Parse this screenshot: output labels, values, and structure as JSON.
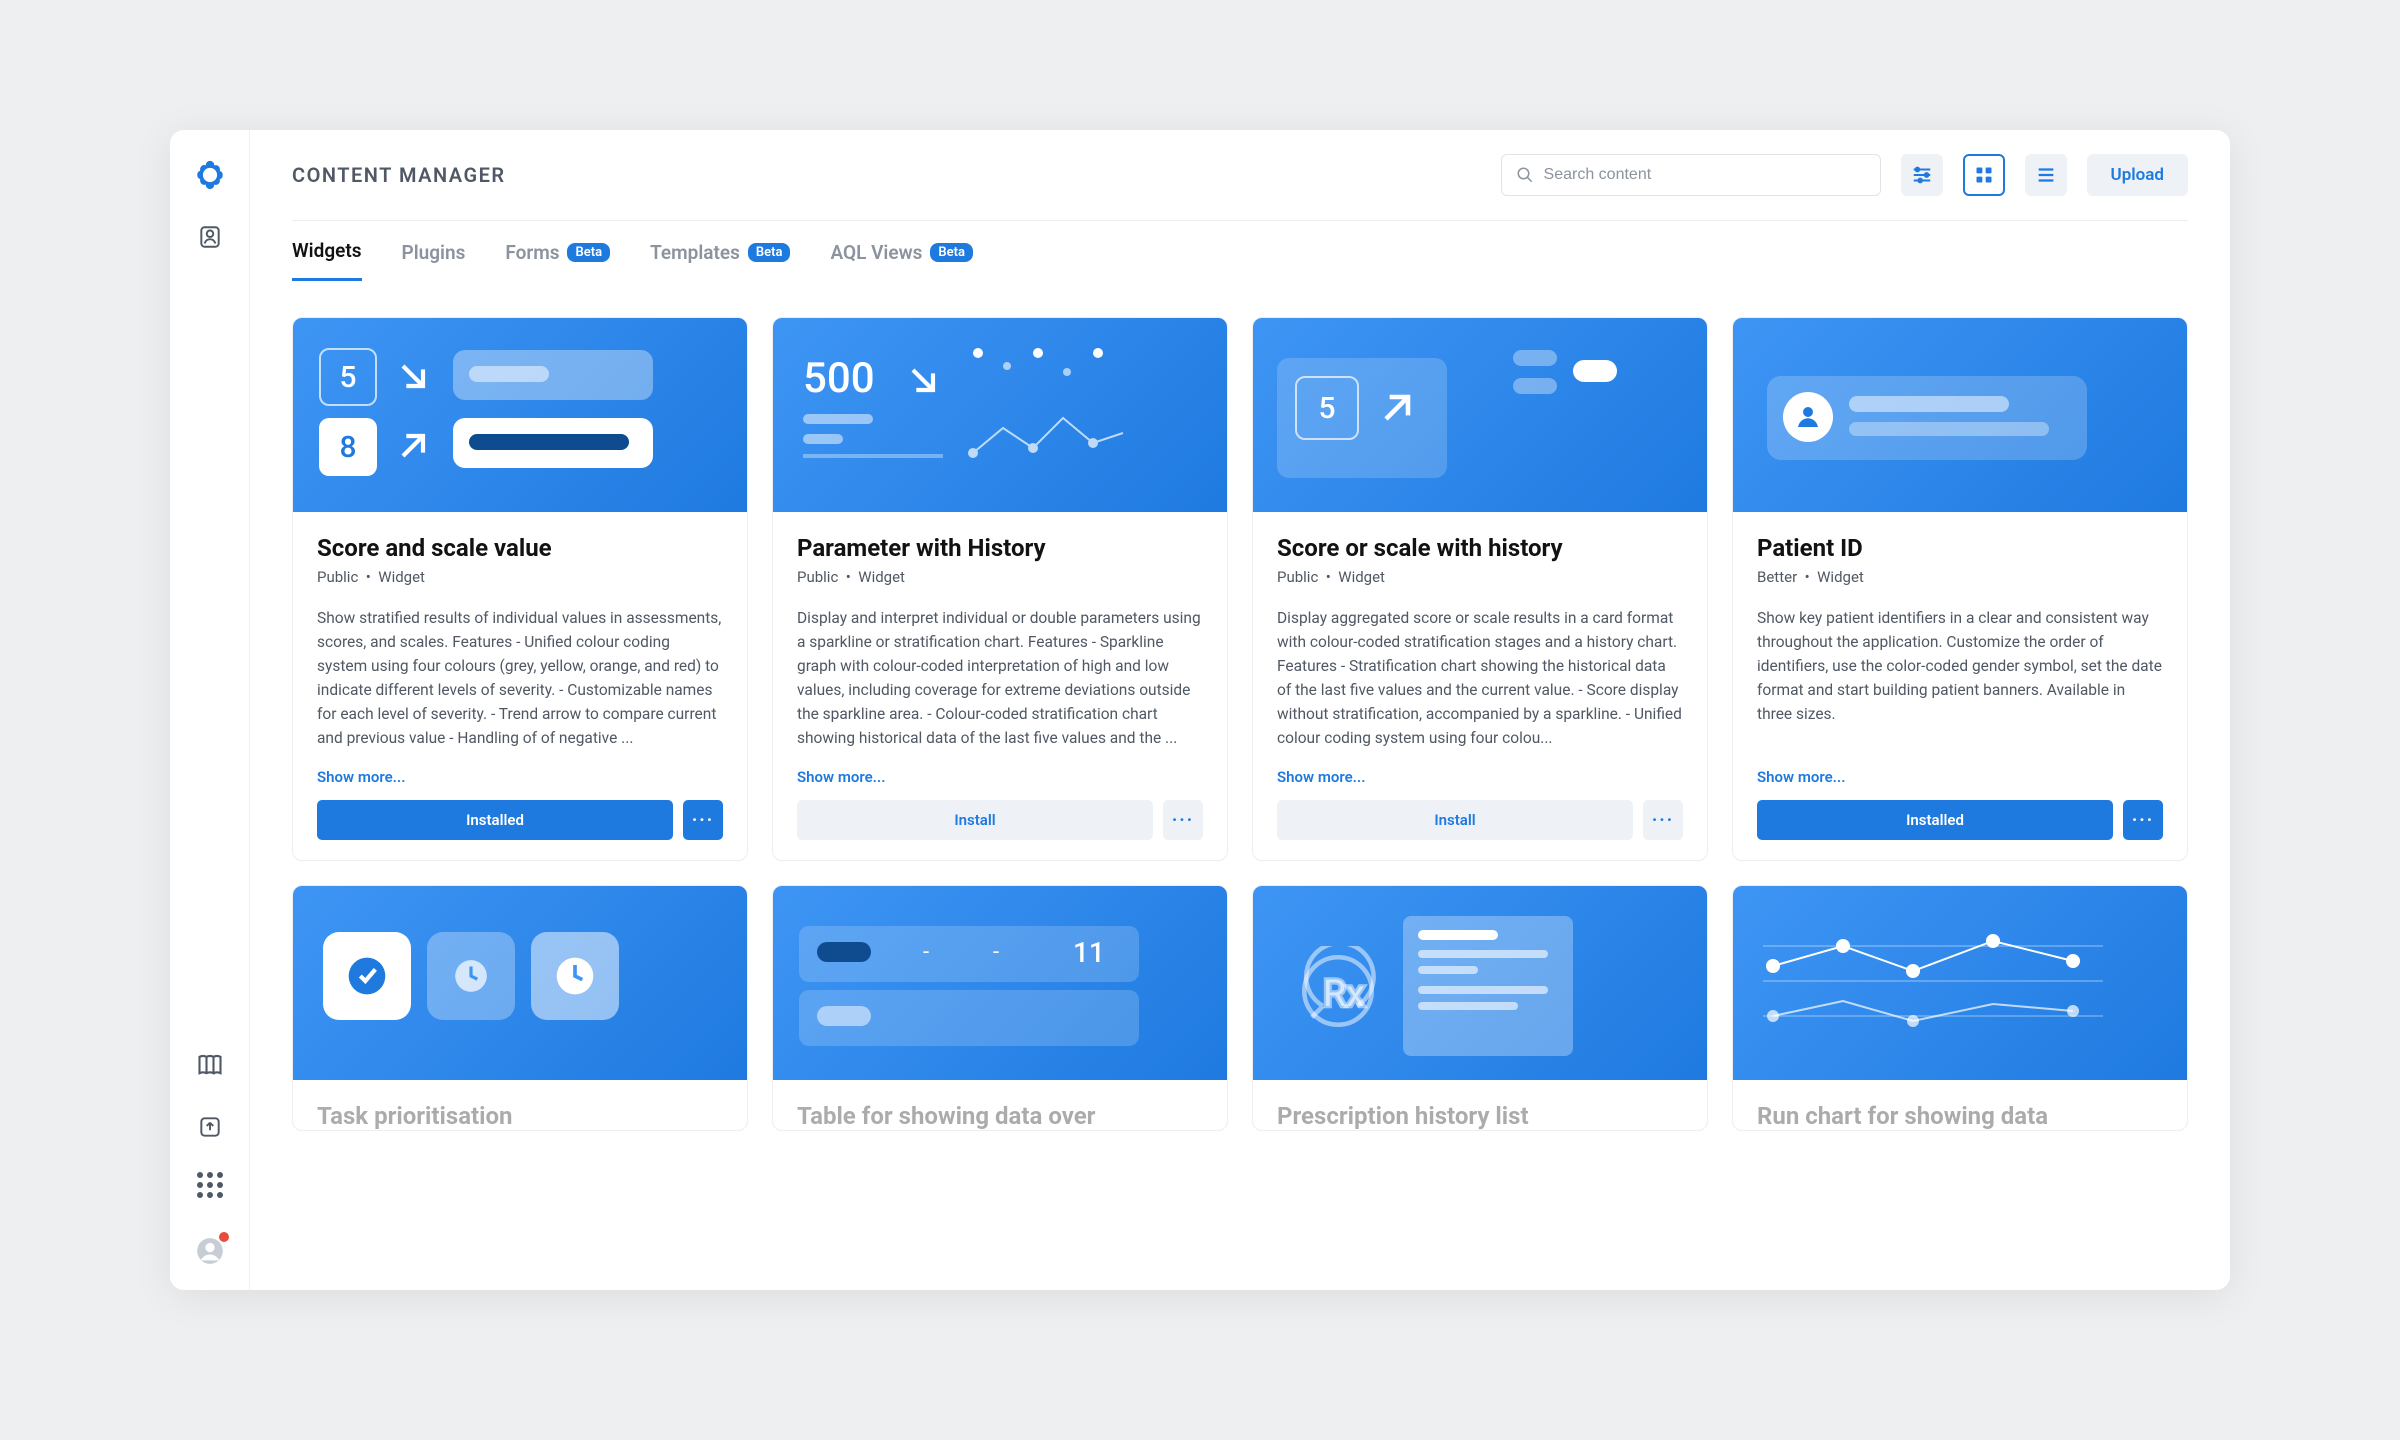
{
  "app_title": "CONTENT MANAGER",
  "search_placeholder": "Search content",
  "upload_label": "Upload",
  "tabs": [
    {
      "label": "Widgets",
      "beta": false,
      "active": true
    },
    {
      "label": "Plugins",
      "beta": false,
      "active": false
    },
    {
      "label": "Forms",
      "beta": true,
      "active": false
    },
    {
      "label": "Templates",
      "beta": true,
      "active": false
    },
    {
      "label": "AQL Views",
      "beta": true,
      "active": false
    }
  ],
  "beta_label": "Beta",
  "show_more_label": "Show more...",
  "install_label": "Install",
  "installed_label": "Installed",
  "more_label": "···",
  "cards": [
    {
      "title": "Score and scale value",
      "scope": "Public",
      "type": "Widget",
      "desc": "Show stratified results of individual values in assessments, scores, and scales. Features - Unified colour coding system using four colours (grey, yellow, orange, and red) to indicate different levels of severity. - Customizable names for each level of severity. - Trend arrow to compare current and previous value - Handling of of negative ...",
      "installed": true
    },
    {
      "title": "Parameter with History",
      "scope": "Public",
      "type": "Widget",
      "desc": "Display and interpret individual or double parameters using a sparkline or stratification chart. Features - Sparkline graph with colour-coded interpretation of high and low values, including coverage for extreme deviations outside the sparkline area. - Colour-coded stratification chart showing historical data of the last five values and the ...",
      "installed": false
    },
    {
      "title": "Score or scale with history",
      "scope": "Public",
      "type": "Widget",
      "desc": "Display aggregated score or scale results in a card format with colour-coded stratification stages and a history chart. Features - Stratification chart showing the historical data of the last five values and the current value. - Score display without stratification, accompanied by a sparkline. - Unified colour coding system using four colou...",
      "installed": false
    },
    {
      "title": "Patient ID",
      "scope": "Better",
      "type": "Widget",
      "desc": "Show key patient identifiers in a clear and consistent way throughout the application. Customize the order of identifiers, use the color-coded gender symbol, set the date format and start building patient banners. Available in three sizes.",
      "installed": true
    }
  ],
  "partial_cards": [
    {
      "title": "Task prioritisation"
    },
    {
      "title": "Table for showing data over"
    },
    {
      "title": "Prescription history list"
    },
    {
      "title": "Run chart for showing data"
    }
  ],
  "hero_numbers": {
    "card0_a": "5",
    "card0_b": "8",
    "card1": "500",
    "card2": "5",
    "partial1": "11"
  }
}
